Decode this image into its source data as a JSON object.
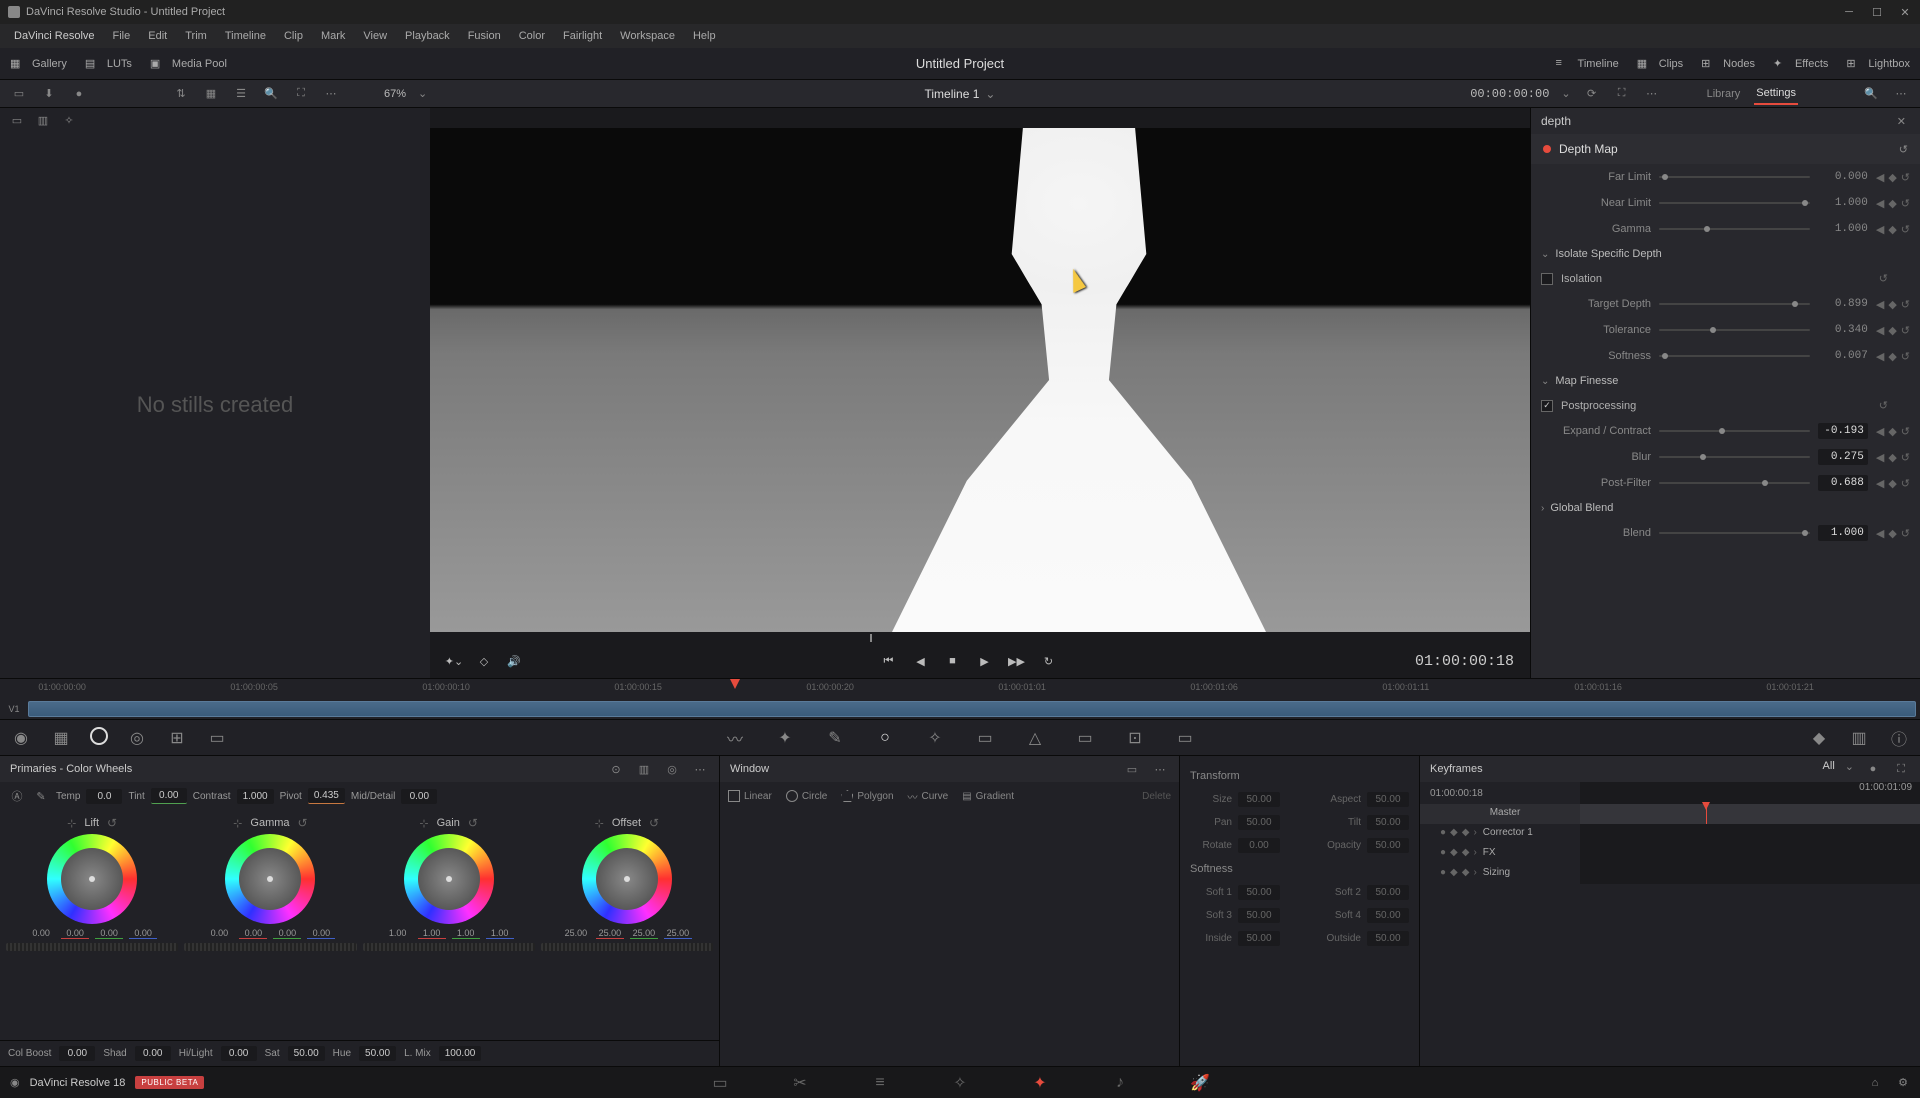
{
  "titlebar": {
    "title": "DaVinci Resolve Studio - Untitled Project"
  },
  "menubar": [
    "DaVinci Resolve",
    "File",
    "Edit",
    "Trim",
    "Timeline",
    "Clip",
    "Mark",
    "View",
    "Playback",
    "Fusion",
    "Color",
    "Fairlight",
    "Workspace",
    "Help"
  ],
  "top_toolbar": {
    "left": [
      {
        "icon": "gallery-icon",
        "label": "Gallery"
      },
      {
        "icon": "luts-icon",
        "label": "LUTs"
      },
      {
        "icon": "mediapool-icon",
        "label": "Media Pool"
      }
    ],
    "project": "Untitled Project",
    "right": [
      {
        "icon": "timeline-icon",
        "label": "Timeline"
      },
      {
        "icon": "clips-icon",
        "label": "Clips"
      },
      {
        "icon": "nodes-icon",
        "label": "Nodes"
      },
      {
        "icon": "effects-icon",
        "label": "Effects"
      },
      {
        "icon": "lightbox-icon",
        "label": "Lightbox"
      }
    ]
  },
  "sub_toolbar": {
    "zoom": "67%",
    "timeline_name": "Timeline 1",
    "timecode": "00:00:00:00",
    "tabs": {
      "library": "Library",
      "settings": "Settings"
    }
  },
  "gallery": {
    "empty_text": "No stills created"
  },
  "transport": {
    "timecode": "01:00:00:18"
  },
  "inspector": {
    "search": "depth",
    "effect_name": "Depth Map",
    "params": {
      "far_limit": {
        "label": "Far Limit",
        "value": "0.000"
      },
      "near_limit": {
        "label": "Near Limit",
        "value": "1.000"
      },
      "gamma": {
        "label": "Gamma",
        "value": "1.000"
      }
    },
    "sections": {
      "isolate": {
        "title": "Isolate Specific Depth",
        "isolation": "Isolation",
        "target_depth": {
          "label": "Target Depth",
          "value": "0.899"
        },
        "tolerance": {
          "label": "Tolerance",
          "value": "0.340"
        },
        "softness": {
          "label": "Softness",
          "value": "0.007"
        }
      },
      "finesse": {
        "title": "Map Finesse",
        "postprocessing": "Postprocessing",
        "expand": {
          "label": "Expand / Contract",
          "value": "-0.193"
        },
        "blur": {
          "label": "Blur",
          "value": "0.275"
        },
        "postfilter": {
          "label": "Post-Filter",
          "value": "0.688"
        }
      },
      "global": {
        "title": "Global Blend",
        "blend": {
          "label": "Blend",
          "value": "1.000"
        }
      }
    }
  },
  "ruler_tcs": [
    "01:00:00:00",
    "01:00:00:05",
    "01:00:00:10",
    "01:00:00:15",
    "01:00:00:20",
    "01:00:01:01",
    "01:00:01:06",
    "01:00:01:11",
    "01:00:01:16",
    "01:00:01:21"
  ],
  "track": {
    "label": "V1"
  },
  "wheels": {
    "title": "Primaries - Color Wheels",
    "adjusts": {
      "temp": {
        "label": "Temp",
        "value": "0.0"
      },
      "tint": {
        "label": "Tint",
        "value": "0.00"
      },
      "contrast": {
        "label": "Contrast",
        "value": "1.000"
      },
      "pivot": {
        "label": "Pivot",
        "value": "0.435"
      },
      "middetail": {
        "label": "Mid/Detail",
        "value": "0.00"
      }
    },
    "groups": [
      {
        "name": "Lift",
        "vals": [
          "0.00",
          "0.00",
          "0.00",
          "0.00"
        ]
      },
      {
        "name": "Gamma",
        "vals": [
          "0.00",
          "0.00",
          "0.00",
          "0.00"
        ]
      },
      {
        "name": "Gain",
        "vals": [
          "1.00",
          "1.00",
          "1.00",
          "1.00"
        ]
      },
      {
        "name": "Offset",
        "vals": [
          "25.00",
          "25.00",
          "25.00",
          "25.00"
        ]
      }
    ],
    "bottom": {
      "colboost": {
        "label": "Col Boost",
        "value": "0.00"
      },
      "shad": {
        "label": "Shad",
        "value": "0.00"
      },
      "hilight": {
        "label": "Hi/Light",
        "value": "0.00"
      },
      "sat": {
        "label": "Sat",
        "value": "50.00"
      },
      "hue": {
        "label": "Hue",
        "value": "50.00"
      },
      "lmix": {
        "label": "L. Mix",
        "value": "100.00"
      }
    }
  },
  "window_panel": {
    "title": "Window",
    "shapes": [
      "Linear",
      "Circle",
      "Polygon",
      "Curve",
      "Gradient"
    ],
    "delete": "Delete"
  },
  "transform": {
    "title": "Transform",
    "fields": {
      "size": {
        "label": "Size",
        "value": "50.00"
      },
      "aspect": {
        "label": "Aspect",
        "value": "50.00"
      },
      "pan": {
        "label": "Pan",
        "value": "50.00"
      },
      "tilt": {
        "label": "Tilt",
        "value": "50.00"
      },
      "rotate": {
        "label": "Rotate",
        "value": "0.00"
      },
      "opacity": {
        "label": "Opacity",
        "value": "50.00"
      }
    },
    "softness_title": "Softness",
    "softness": {
      "soft1": {
        "label": "Soft 1",
        "value": "50.00"
      },
      "soft2": {
        "label": "Soft 2",
        "value": "50.00"
      },
      "soft3": {
        "label": "Soft 3",
        "value": "50.00"
      },
      "soft4": {
        "label": "Soft 4",
        "value": "50.00"
      },
      "inside": {
        "label": "Inside",
        "value": "50.00"
      },
      "outside": {
        "label": "Outside",
        "value": "50.00"
      }
    }
  },
  "keyframes": {
    "title": "Keyframes",
    "all": "All",
    "tc_start": "01:00:00:18",
    "tc_end": "01:00:01:09",
    "items": [
      "Master",
      "Corrector 1",
      "FX",
      "Sizing"
    ]
  },
  "pagebar": {
    "app": "DaVinci Resolve 18",
    "badge": "PUBLIC BETA"
  }
}
